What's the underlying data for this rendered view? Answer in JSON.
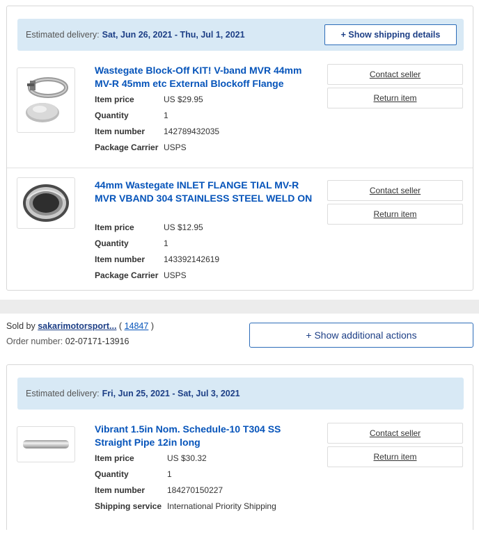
{
  "order1": {
    "delivery": {
      "label": "Estimated delivery:",
      "dates": "Sat, Jun 26, 2021 - Thu, Jul 1, 2021",
      "show_details_label": "+ Show shipping details"
    },
    "items": [
      {
        "title": "Wastegate Block-Off KIT! V-band MVR 44mm MV-R 45mm etc External Blockoff Flange",
        "props": [
          {
            "label": "Item price",
            "value": "US $29.95"
          },
          {
            "label": "Quantity",
            "value": "1"
          },
          {
            "label": "Item number",
            "value": "142789432035"
          },
          {
            "label": "Package Carrier",
            "value": "USPS"
          }
        ],
        "contact_label": "Contact seller",
        "return_label": "Return item",
        "image_icon": "vband-clamp-flange-photo"
      },
      {
        "title": "44mm Wastegate INLET FLANGE TIAL MV-R MVR VBAND 304 STAINLESS STEEL WELD ON",
        "props": [
          {
            "label": "Item price",
            "value": "US $12.95"
          },
          {
            "label": "Quantity",
            "value": "1"
          },
          {
            "label": "Item number",
            "value": "143392142619"
          },
          {
            "label": "Package Carrier",
            "value": "USPS"
          }
        ],
        "contact_label": "Contact seller",
        "return_label": "Return item",
        "image_icon": "steel-ring-flange-photo"
      }
    ]
  },
  "seller": {
    "sold_by_label": "Sold by",
    "name": "sakarimotorsport...",
    "feedback_open": "(",
    "feedback_count": "14847",
    "feedback_close": ")",
    "order_number_label": "Order number:",
    "order_number": "02-07171-13916",
    "additional_actions_label": "+ Show additional actions"
  },
  "order2": {
    "delivery": {
      "label": "Estimated delivery:",
      "dates": "Fri, Jun 25, 2021 - Sat, Jul 3, 2021"
    },
    "items": [
      {
        "title": "Vibrant 1.5in Nom. Schedule-10 T304 SS Straight Pipe 12in long",
        "props": [
          {
            "label": "Item price",
            "value": "US $30.32"
          },
          {
            "label": "Quantity",
            "value": "1"
          },
          {
            "label": "Item number",
            "value": "184270150227"
          },
          {
            "label": "Shipping service",
            "value": "International Priority Shipping"
          }
        ],
        "contact_label": "Contact seller",
        "return_label": "Return item",
        "image_icon": "steel-pipe-photo"
      }
    ]
  },
  "colors": {
    "link_blue": "#0654ba",
    "banner_bg": "#d8e9f5",
    "banner_text": "#1d3f86"
  }
}
